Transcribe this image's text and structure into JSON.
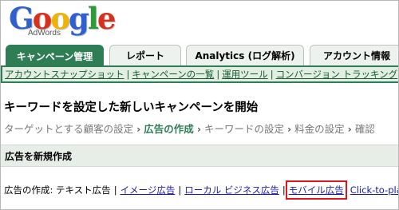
{
  "logo": {
    "letters": [
      "G",
      "o",
      "o",
      "g",
      "l",
      "e"
    ],
    "subtitle": "AdWords"
  },
  "tabs": [
    {
      "label": "キャンペーン管理",
      "active": true
    },
    {
      "label": "レポート",
      "active": false
    },
    {
      "label": "Analytics (ログ解析)",
      "active": false
    },
    {
      "label": "アカウント情報",
      "active": false
    }
  ],
  "subnav": [
    "アカウントスナップショット",
    "キャンペーンの一覧",
    "運用ツール",
    "コンバージョン トラッキング"
  ],
  "page_title": "キーワードを設定した新しいキャンペーンを開始",
  "steps": [
    "ターゲットとする顧客の設定",
    "広告の作成",
    "キーワードの設定",
    "料金の設定",
    "確認"
  ],
  "current_step_index": 1,
  "section_title": "広告を新規作成",
  "ad_types": {
    "prefix": "広告の作成: テキスト広告",
    "links": [
      "イメージ広告",
      "ローカル ビジネス広告",
      "モバイル広告",
      "Click-to-play"
    ]
  },
  "colors": {
    "accent": "#2e7d55",
    "highlight_box": "#e0141b",
    "link": "#1a1aa6"
  }
}
